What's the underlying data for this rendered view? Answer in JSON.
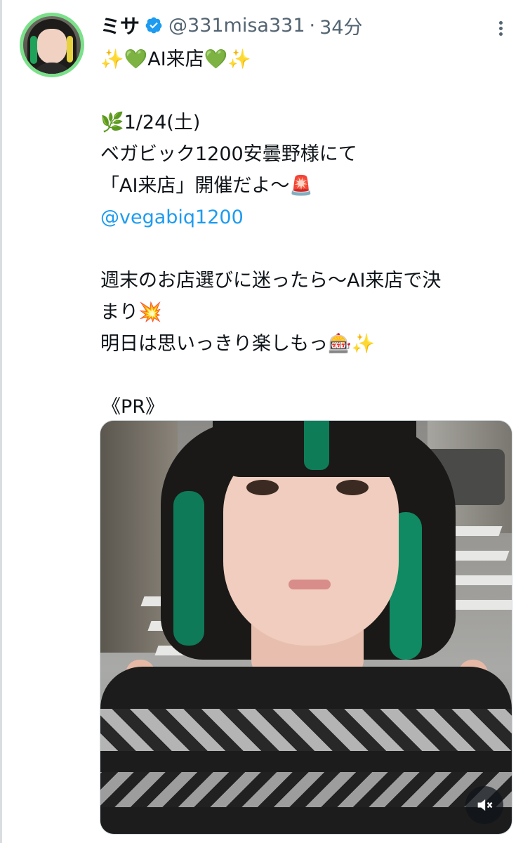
{
  "author": {
    "display_name": "ミサ",
    "handle": "@331misa331",
    "separator": "·",
    "time_ago": "34分"
  },
  "tweet": {
    "line1": "✨💚AI来店💚✨",
    "line2": "🌿1/24(土)",
    "line3": "ベガビック1200安曇野様にて",
    "line4": "「AI来店」開催だよ〜🚨",
    "mention": "@vegabiq1200",
    "line5": "週末のお店選びに迷ったら〜AI来店で決",
    "line6": "まり💥",
    "line7": "明日は思いっきり楽しもっ🎰✨",
    "line8": "《PR》"
  },
  "icons": {
    "verified": "verified-badge-icon",
    "more": "more-options-icon",
    "mute": "volume-muted-icon"
  },
  "colors": {
    "link": "#1d9bf0",
    "verified": "#1d9bf0",
    "secondary_text": "#536471",
    "avatar_ring": "#7be08a"
  }
}
